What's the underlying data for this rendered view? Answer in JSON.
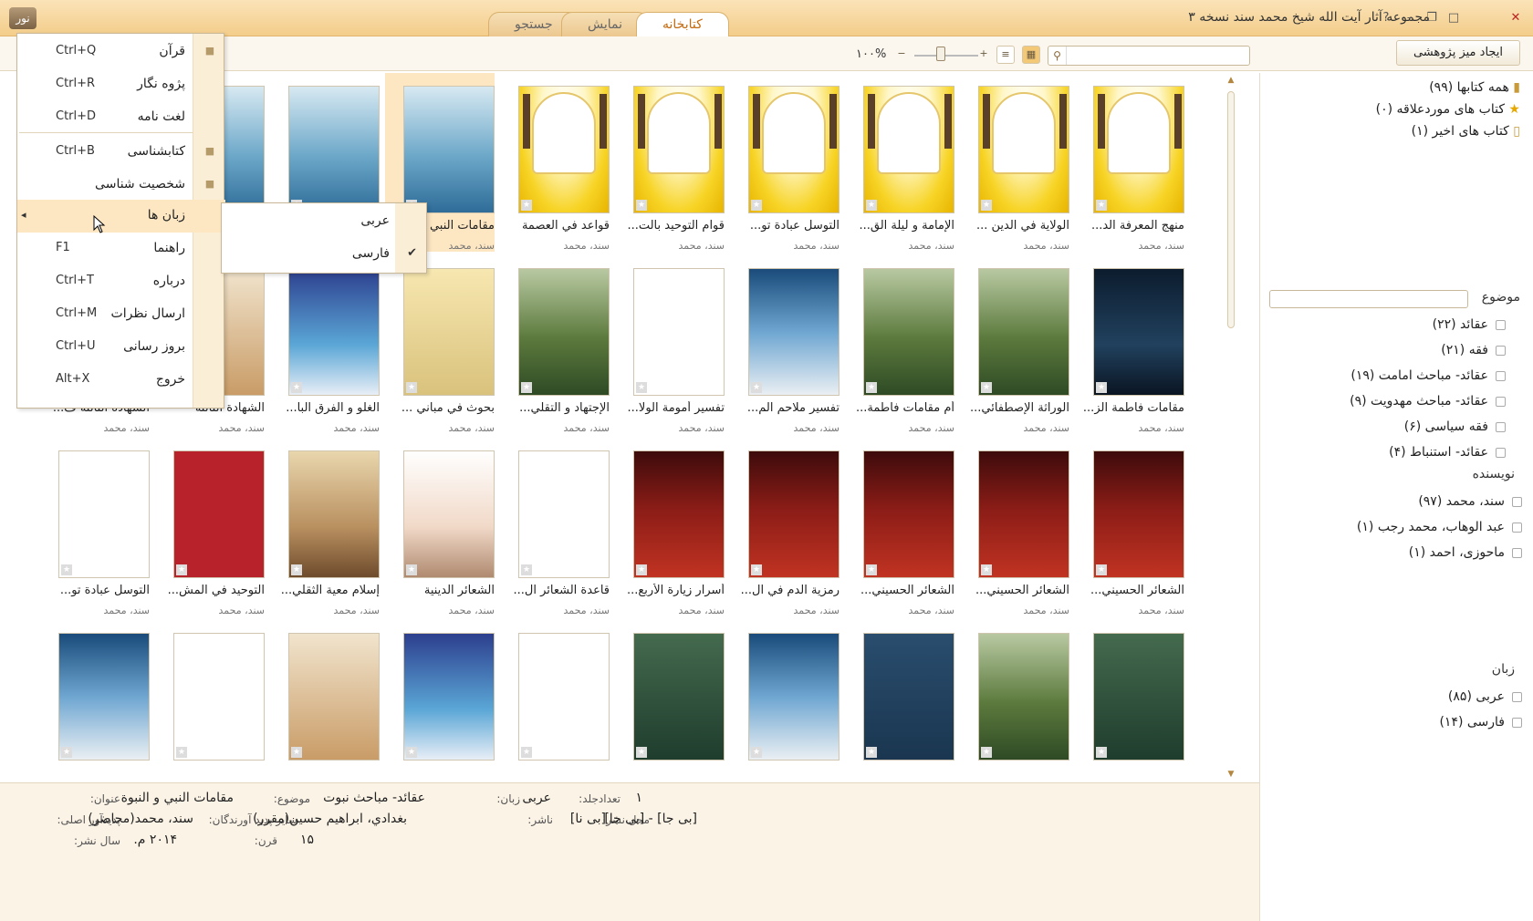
{
  "window": {
    "title": "مجموعه آثار آیت الله شیخ محمد سند نسخه ۳",
    "logo": "نور",
    "controls": [
      "close-icon",
      "maximize-icon",
      "restore-icon",
      "minimize-icon",
      "help-icon"
    ]
  },
  "tabs": [
    {
      "label": "کتابخانه",
      "active": true
    },
    {
      "label": "نمایش",
      "active": false
    },
    {
      "label": "جستجو",
      "active": false
    }
  ],
  "toolbar": {
    "research_desk": "ایجاد میز پژوهشی",
    "search_placeholder": "",
    "zoom": "۱۰۰%",
    "zoom_minus": "−",
    "zoom_plus": "+"
  },
  "menu": {
    "items": [
      {
        "label": "قرآن",
        "shortcut": "Ctrl+Q"
      },
      {
        "label": "پژوه نگار",
        "shortcut": "Ctrl+R"
      },
      {
        "label": "لغت نامه",
        "shortcut": "Ctrl+D"
      },
      {
        "label": "کتابشناسی",
        "shortcut": "Ctrl+B"
      },
      {
        "label": "شخصیت شناسی",
        "shortcut": ""
      },
      {
        "label": "زبان ها",
        "shortcut": ""
      },
      {
        "label": "راهنما",
        "shortcut": "F1"
      },
      {
        "label": "درباره",
        "shortcut": "Ctrl+T"
      },
      {
        "label": "ارسال نظرات",
        "shortcut": "Ctrl+M"
      },
      {
        "label": "بروز رسانی",
        "shortcut": "Ctrl+U"
      },
      {
        "label": "خروج",
        "shortcut": "Alt+X"
      }
    ],
    "submenu": [
      {
        "label": "عربی",
        "checked": false
      },
      {
        "label": "فارسی",
        "checked": true
      }
    ]
  },
  "books": [
    [
      {
        "title": "منهج المعرفة الد...",
        "author": "سند، محمد",
        "cover": "yellow"
      },
      {
        "title": "الولاية في الدين ...",
        "author": "سند، محمد",
        "cover": "yellow"
      },
      {
        "title": "الإمامة و ليلة الق...",
        "author": "سند، محمد",
        "cover": "yellow"
      },
      {
        "title": "التوسل عبادة تو...",
        "author": "سند، محمد",
        "cover": "yellow"
      },
      {
        "title": "قوام التوحيد بالت...",
        "author": "سند، محمد",
        "cover": "yellow"
      },
      {
        "title": "قواعد في العصمة",
        "author": "سند، محمد",
        "cover": "yellow"
      },
      {
        "title": "مقامات النبي",
        "author": "سند، محمد",
        "cover": "blue",
        "selected": true
      },
      {
        "title": "",
        "author": "",
        "cover": "blue"
      },
      {
        "title": "",
        "author": "",
        "cover": "blue"
      },
      {
        "title": "",
        "author": "",
        "cover": "gray"
      }
    ],
    [
      {
        "title": "مقامات فاطمة الز...",
        "author": "سند، محمد",
        "cover": "dark"
      },
      {
        "title": "الوراثة الإصطفائي...",
        "author": "سند، محمد",
        "cover": "green"
      },
      {
        "title": "أم مقامات فاطمة...",
        "author": "سند، محمد",
        "cover": "green"
      },
      {
        "title": "تفسير ملاحم الم...",
        "author": "سند، محمد",
        "cover": "sky"
      },
      {
        "title": "تفسير أمومة الولا...",
        "author": "سند، محمد",
        "cover": "white"
      },
      {
        "title": "الإجتهاد و التقلي...",
        "author": "سند، محمد",
        "cover": "green"
      },
      {
        "title": "بحوث في مباني ...",
        "author": "سند، محمد",
        "cover": "arch"
      },
      {
        "title": "الغلو و الفرق البا...",
        "author": "سند، محمد",
        "cover": "glass"
      },
      {
        "title": "الشهادة الثالثة",
        "author": "سند، محمد",
        "cover": "warm"
      },
      {
        "title": "الشهادة الثالثة ف...",
        "author": "سند، محمد",
        "cover": "warm"
      }
    ],
    [
      {
        "title": "الشعائر الحسيني...",
        "author": "سند، محمد",
        "cover": "red"
      },
      {
        "title": "الشعائر الحسيني...",
        "author": "سند، محمد",
        "cover": "red"
      },
      {
        "title": "الشعائر الحسيني...",
        "author": "سند، محمد",
        "cover": "red"
      },
      {
        "title": "رمزية الدم في ال...",
        "author": "سند، محمد",
        "cover": "red"
      },
      {
        "title": "أسرار زيارة الأربع...",
        "author": "سند، محمد",
        "cover": "red"
      },
      {
        "title": "قاعدة الشعائر ال...",
        "author": "سند، محمد",
        "cover": "white"
      },
      {
        "title": "الشعائر الدينية",
        "author": "سند، محمد",
        "cover": "tree"
      },
      {
        "title": "إسلام معية الثقلي...",
        "author": "سند، محمد",
        "cover": "brown"
      },
      {
        "title": "التوحيد في المش...",
        "author": "سند، محمد",
        "cover": "crimson"
      },
      {
        "title": "التوسل عبادة تو...",
        "author": "سند، محمد",
        "cover": "white"
      }
    ],
    [
      {
        "title": "",
        "author": "",
        "cover": "darkgreen"
      },
      {
        "title": "",
        "author": "",
        "cover": "green"
      },
      {
        "title": "",
        "author": "",
        "cover": "teal"
      },
      {
        "title": "",
        "author": "",
        "cover": "sky"
      },
      {
        "title": "",
        "author": "",
        "cover": "darkgreen"
      },
      {
        "title": "",
        "author": "",
        "cover": "white"
      },
      {
        "title": "",
        "author": "",
        "cover": "glass"
      },
      {
        "title": "",
        "author": "",
        "cover": "warm"
      },
      {
        "title": "",
        "author": "",
        "cover": "white"
      },
      {
        "title": "",
        "author": "",
        "cover": "sky"
      }
    ]
  ],
  "side": {
    "collections": [
      {
        "label": "همه کتابها (۹۹)",
        "icon": "books-icon"
      },
      {
        "label": "کتاب های موردعلاقه (۰)",
        "icon": "star-icon"
      },
      {
        "label": "کتاب های اخیر (۱)",
        "icon": "recent-icon"
      }
    ],
    "topic_head": "موضوع",
    "topics": [
      "عقائد (۲۲)",
      "فقه (۲۱)",
      "عقائد- مباحث امامت (۱۹)",
      "عقائد- مباحث مهدویت (۹)",
      "فقه سیاسی (۶)",
      "عقائد- استنباط (۴)"
    ],
    "author_head": "نویسنده",
    "authors": [
      "سند، محمد (۹۷)",
      "عبد الوهاب، محمد رجب (۱)",
      "ماحوزی، احمد (۱)"
    ],
    "lang_head": "زبان",
    "langs": [
      "عربی (۸۵)",
      "فارسی (۱۴)"
    ]
  },
  "details": {
    "title_l": "عنوان:",
    "title": "مقامات النبي و النبوة",
    "topic_l": "موضوع:",
    "topic": "عقائد- مباحث نبوت",
    "lang_l": "زبان:",
    "lang": "عربی",
    "vol_l": "تعدادجلد:",
    "vol": "۱",
    "creator_l": "پدیدآور اصلی:",
    "creator": "سند، محمد(محاضر)",
    "others_l": "سایر پدید آورندگان:",
    "others": "بغدادي، ابراهيم حسين(مقرر)",
    "pub_l": "ناشر:",
    "pub": "[بی نا]",
    "place_l": "محل نشر:",
    "place": "[بی جا] - [بی جا]",
    "year_l": "سال نشر:",
    "year": "۲۰۱۴ م.",
    "century_l": "قرن:",
    "century": "۱۵"
  }
}
